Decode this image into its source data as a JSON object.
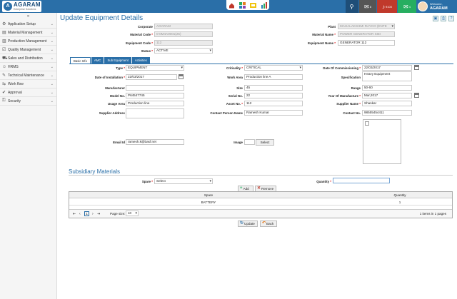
{
  "topbar": {
    "brand": "AGARAM",
    "brand_sub": "Enterprise Solutions",
    "mail_count": "8",
    "alert_count": "9100",
    "chat_count": "4",
    "welcome_label": "Welcome,",
    "user_name": "AGARAM"
  },
  "sidebar": {
    "items": [
      {
        "label": "Application Setup",
        "icon": "gear-icon"
      },
      {
        "label": "Material Management",
        "icon": "box-icon"
      },
      {
        "label": "Production Management",
        "icon": "factory-icon"
      },
      {
        "label": "Quality Management",
        "icon": "check-icon"
      },
      {
        "label": "Sales and Distribution",
        "icon": "truck-icon"
      },
      {
        "label": "HRMS",
        "icon": "people-icon"
      },
      {
        "label": "Technical Maintenance",
        "icon": "wrench-icon"
      },
      {
        "label": "Work flow",
        "icon": "flow-icon"
      },
      {
        "label": "Approval",
        "icon": "tick-icon"
      },
      {
        "label": "Security",
        "icon": "lock-icon"
      }
    ]
  },
  "page": {
    "title": "Update Equipment Details"
  },
  "header_form": {
    "corporate_label": "Corporate",
    "corporate_value": "AGARAM",
    "plant_label": "Plant",
    "plant_value": "MAHALAKSHMI RAYCO (ENTE",
    "material_code_label": "Material Code",
    "material_code_value": "0-0M4A0001(25)",
    "material_name_label": "Material Name",
    "material_name_value": "POWER GENERATOR SIEI",
    "equipment_code_label": "Equipment Code",
    "equipment_code_value": "112",
    "equipment_name_label": "Equipment Name",
    "equipment_name_value": "GENERATOR 112",
    "status_label": "Status",
    "status_value": "ACTIVE"
  },
  "tabs": [
    {
      "label": "Basic Info",
      "active": true
    },
    {
      "label": "AMC",
      "active": false
    },
    {
      "label": "Sub Equipment",
      "active": false
    },
    {
      "label": "Activities",
      "active": false
    }
  ],
  "basic_info": {
    "type_label": "Type",
    "type_value": "EQUIPMENT",
    "criticality_label": "Criticality",
    "criticality_value": "CRITICAL",
    "commissioning_label": "Date Of Commissioning",
    "commissioning_value": "22/03/2017",
    "installation_label": "Date of Installation",
    "installation_value": "22/03/2017",
    "work_area_label": "Work Area",
    "work_area_value": "Production line A",
    "specification_label": "Specification",
    "specification_value": "Heavy Equipment",
    "manufacturer_label": "Manufacturer",
    "manufacturer_value": "",
    "size_label": "Size",
    "size_value": "45",
    "range_label": "Range",
    "range_value": "50-60",
    "model_label": "Model No.",
    "model_value": "P64547745",
    "serial_label": "Serial No.",
    "serial_value": "22",
    "year_label": "Year Of Manufacture",
    "year_value": "Mar,2017",
    "usage_label": "Usage Area",
    "usage_value": "Production line",
    "asset_label": "Asset No.",
    "asset_value": "112",
    "supplier_name_label": "Supplier Name",
    "supplier_name_value": "Shankar",
    "supplier_address_label": "Supplier Address",
    "supplier_address_value": "",
    "contact_person_label": "Contact Person Name",
    "contact_person_value": "Ramesh Kumar",
    "contact_no_label": "Contact No.",
    "contact_no_value": "98555454411",
    "email_label": "Email Id",
    "email_value": "ramesh.k@basf.net",
    "image_label": "Image",
    "image_button": "Select"
  },
  "subsidiary": {
    "title": "Subsidiary Materials",
    "spare_label": "Spare",
    "spare_value": "Select",
    "quantity_label": "Quantity",
    "quantity_value": "",
    "add_label": "Add",
    "remove_label": "Remove",
    "columns": [
      "Spare",
      "Quantity"
    ],
    "rows": [
      {
        "spare": "BATTERY",
        "quantity": "1"
      }
    ],
    "page_number": "1",
    "page_size_label": "Page size:",
    "page_size_value": "10",
    "items_info": "1 items in 1 pages"
  },
  "actions": {
    "update_label": "Update",
    "back_label": "Back"
  },
  "colors": {
    "primary": "#2a6fa8",
    "title": "#2a6fa8"
  }
}
